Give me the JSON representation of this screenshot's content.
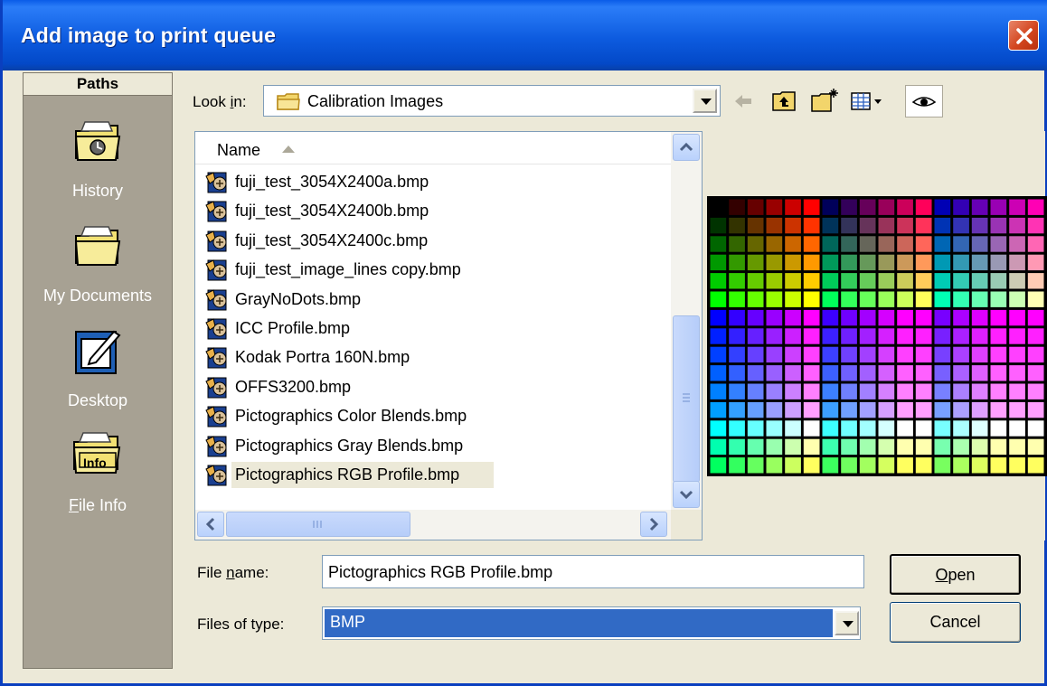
{
  "window": {
    "title": "Add image to print queue"
  },
  "paths": {
    "header": "Paths",
    "items": [
      {
        "label": "History",
        "icon": "history-folder-icon"
      },
      {
        "label": "My Documents",
        "icon": "my-documents-folder-icon"
      },
      {
        "label": "Desktop",
        "icon": "desktop-icon"
      },
      {
        "label_prefix": "",
        "label_underline": "F",
        "label_rest": "ile Info",
        "icon": "file-info-folder-icon",
        "badge": "Info"
      }
    ]
  },
  "lookin": {
    "label_pre": "Look ",
    "label_u": "i",
    "label_post": "n:",
    "value": "Calibration Images"
  },
  "filelist": {
    "column": "Name",
    "files": [
      "fuji_test_3054X2400a.bmp",
      "fuji_test_3054X2400b.bmp",
      "fuji_test_3054X2400c.bmp",
      "fuji_test_image_lines copy.bmp",
      "GrayNoDots.bmp",
      "ICC Profile.bmp",
      "Kodak Portra 160N.bmp",
      "OFFS3200.bmp",
      "Pictographics Color Blends.bmp",
      "Pictographics Gray Blends.bmp",
      "Pictographics RGB Profile.bmp"
    ],
    "selected_index": 10
  },
  "form": {
    "file_name_label_pre": "File ",
    "file_name_label_u": "n",
    "file_name_label_post": "ame:",
    "file_name_value": "Pictographics RGB Profile.bmp",
    "files_of_type_label": "Files of type:",
    "files_of_type_value": "BMP",
    "open_u": "O",
    "open_rest": "pen",
    "cancel_label": "Cancel"
  },
  "colors": {
    "titlebar": "#0a5ce8",
    "sidebar": "#a7a193",
    "selection": "#316ac5",
    "dialog_bg": "#ece9d8"
  }
}
